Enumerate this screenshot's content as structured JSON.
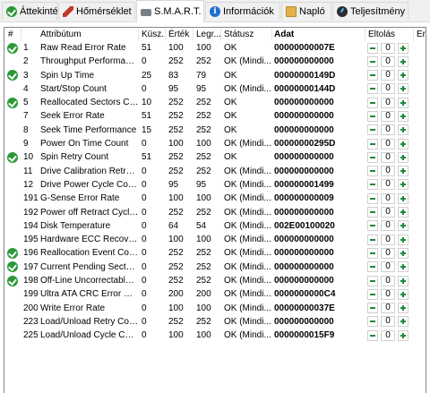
{
  "tabs": [
    {
      "label": "Áttekintés",
      "icon": "check-icon"
    },
    {
      "label": "Hőmérséklet",
      "icon": "thermometer-icon"
    },
    {
      "label": "S.M.A.R.T.",
      "icon": "hard-drive-icon"
    },
    {
      "label": "Információk",
      "icon": "info-icon"
    },
    {
      "label": "Napló",
      "icon": "log-icon"
    },
    {
      "label": "Teljesítmény",
      "icon": "performance-icon"
    }
  ],
  "active_tab": "S.M.A.R.T.",
  "columns": {
    "num": "#",
    "attribute": "Attribútum",
    "current": "Küsz...",
    "worst": "Érték",
    "threshold": "Legr...",
    "status": "Státusz",
    "data": "Adat",
    "offset": "Eltolás",
    "extra": "Er"
  },
  "rows": [
    {
      "ok": true,
      "num": "1",
      "attr": "Raw Read Error Rate",
      "cur": "51",
      "wor": "100",
      "thr": "100",
      "status": "OK",
      "data": "00000000007E",
      "offset": "0"
    },
    {
      "ok": false,
      "num": "2",
      "attr": "Throughput Performance",
      "cur": "0",
      "wor": "252",
      "thr": "252",
      "status": "OK (Mindi...",
      "data": "000000000000",
      "offset": "0"
    },
    {
      "ok": true,
      "num": "3",
      "attr": "Spin Up Time",
      "cur": "25",
      "wor": "83",
      "thr": "79",
      "status": "OK",
      "data": "00000000149D",
      "offset": "0"
    },
    {
      "ok": false,
      "num": "4",
      "attr": "Start/Stop Count",
      "cur": "0",
      "wor": "95",
      "thr": "95",
      "status": "OK (Mindi...",
      "data": "00000000144D",
      "offset": "0"
    },
    {
      "ok": true,
      "num": "5",
      "attr": "Reallocated Sectors Co...",
      "cur": "10",
      "wor": "252",
      "thr": "252",
      "status": "OK",
      "data": "000000000000",
      "offset": "0"
    },
    {
      "ok": false,
      "num": "7",
      "attr": "Seek Error Rate",
      "cur": "51",
      "wor": "252",
      "thr": "252",
      "status": "OK",
      "data": "000000000000",
      "offset": "0"
    },
    {
      "ok": false,
      "num": "8",
      "attr": "Seek Time Performance",
      "cur": "15",
      "wor": "252",
      "thr": "252",
      "status": "OK",
      "data": "000000000000",
      "offset": "0"
    },
    {
      "ok": false,
      "num": "9",
      "attr": "Power On Time Count",
      "cur": "0",
      "wor": "100",
      "thr": "100",
      "status": "OK (Mindi...",
      "data": "00000000295D",
      "offset": "0"
    },
    {
      "ok": true,
      "num": "10",
      "attr": "Spin Retry Count",
      "cur": "51",
      "wor": "252",
      "thr": "252",
      "status": "OK",
      "data": "000000000000",
      "offset": "0"
    },
    {
      "ok": false,
      "num": "11",
      "attr": "Drive Calibration Retry ...",
      "cur": "0",
      "wor": "252",
      "thr": "252",
      "status": "OK (Mindi...",
      "data": "000000000000",
      "offset": "0"
    },
    {
      "ok": false,
      "num": "12",
      "attr": "Drive Power Cycle Count",
      "cur": "0",
      "wor": "95",
      "thr": "95",
      "status": "OK (Mindi...",
      "data": "000000001499",
      "offset": "0"
    },
    {
      "ok": false,
      "num": "191",
      "attr": "G-Sense Error Rate",
      "cur": "0",
      "wor": "100",
      "thr": "100",
      "status": "OK (Mindi...",
      "data": "000000000009",
      "offset": "0"
    },
    {
      "ok": false,
      "num": "192",
      "attr": "Power off Retract Cycle ...",
      "cur": "0",
      "wor": "252",
      "thr": "252",
      "status": "OK (Mindi...",
      "data": "000000000000",
      "offset": "0"
    },
    {
      "ok": false,
      "num": "194",
      "attr": "Disk Temperature",
      "cur": "0",
      "wor": "64",
      "thr": "54",
      "status": "OK (Mindi...",
      "data": "002E00100020",
      "offset": "0"
    },
    {
      "ok": false,
      "num": "195",
      "attr": "Hardware ECC Recovered",
      "cur": "0",
      "wor": "100",
      "thr": "100",
      "status": "OK (Mindi...",
      "data": "000000000000",
      "offset": "0"
    },
    {
      "ok": true,
      "num": "196",
      "attr": "Reallocation Event Count",
      "cur": "0",
      "wor": "252",
      "thr": "252",
      "status": "OK (Mindi...",
      "data": "000000000000",
      "offset": "0"
    },
    {
      "ok": true,
      "num": "197",
      "attr": "Current Pending Sector...",
      "cur": "0",
      "wor": "252",
      "thr": "252",
      "status": "OK (Mindi...",
      "data": "000000000000",
      "offset": "0"
    },
    {
      "ok": true,
      "num": "198",
      "attr": "Off-Line Uncorrectable ...",
      "cur": "0",
      "wor": "252",
      "thr": "252",
      "status": "OK (Mindi...",
      "data": "000000000000",
      "offset": "0"
    },
    {
      "ok": false,
      "num": "199",
      "attr": "Ultra ATA CRC Error Co...",
      "cur": "0",
      "wor": "200",
      "thr": "200",
      "status": "OK (Mindi...",
      "data": "0000000000C4",
      "offset": "0"
    },
    {
      "ok": false,
      "num": "200",
      "attr": "Write Error Rate",
      "cur": "0",
      "wor": "100",
      "thr": "100",
      "status": "OK (Mindi...",
      "data": "00000000037E",
      "offset": "0"
    },
    {
      "ok": false,
      "num": "223",
      "attr": "Load/Unload Retry Cou...",
      "cur": "0",
      "wor": "252",
      "thr": "252",
      "status": "OK (Mindi...",
      "data": "000000000000",
      "offset": "0"
    },
    {
      "ok": false,
      "num": "225",
      "attr": "Load/Unload Cycle Cou...",
      "cur": "0",
      "wor": "100",
      "thr": "100",
      "status": "OK (Mindi...",
      "data": "0000000015F9",
      "offset": "0"
    }
  ]
}
